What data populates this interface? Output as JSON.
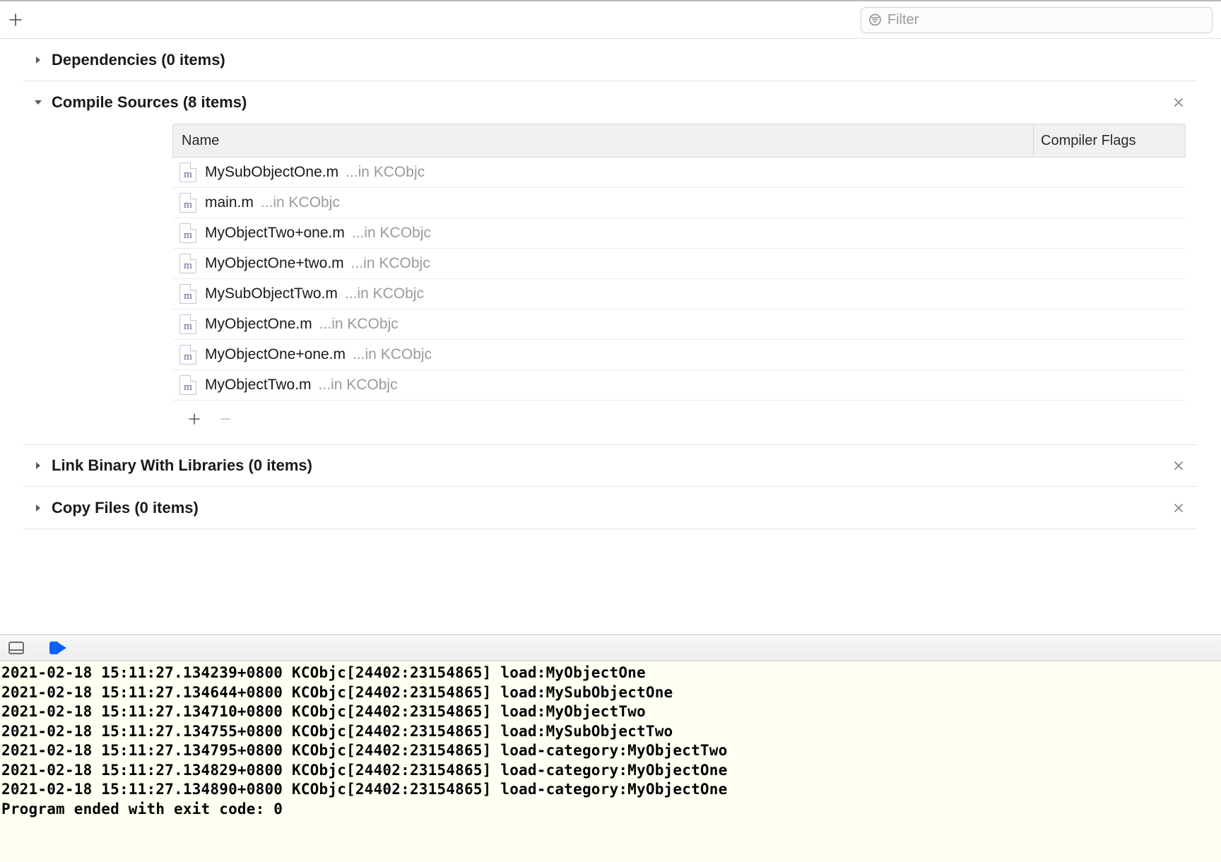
{
  "toolbar": {
    "filter_placeholder": "Filter"
  },
  "sections": {
    "dependencies": {
      "title": "Dependencies (0 items)",
      "expanded": false
    },
    "compile_sources": {
      "title": "Compile Sources (8 items)",
      "expanded": true
    },
    "link_binary": {
      "title": "Link Binary With Libraries (0 items)",
      "expanded": false
    },
    "copy_files": {
      "title": "Copy Files (0 items)",
      "expanded": false
    }
  },
  "table": {
    "columns": {
      "name": "Name",
      "flags": "Compiler Flags"
    },
    "rows": [
      {
        "file": "MySubObjectOne.m",
        "location": "...in KCObjc",
        "flags": ""
      },
      {
        "file": "main.m",
        "location": "...in KCObjc",
        "flags": ""
      },
      {
        "file": "MyObjectTwo+one.m",
        "location": "...in KCObjc",
        "flags": ""
      },
      {
        "file": "MyObjectOne+two.m",
        "location": "...in KCObjc",
        "flags": ""
      },
      {
        "file": "MySubObjectTwo.m",
        "location": "...in KCObjc",
        "flags": ""
      },
      {
        "file": "MyObjectOne.m",
        "location": "...in KCObjc",
        "flags": ""
      },
      {
        "file": "MyObjectOne+one.m",
        "location": "...in KCObjc",
        "flags": ""
      },
      {
        "file": "MyObjectTwo.m",
        "location": "...in KCObjc",
        "flags": ""
      }
    ],
    "file_icon_letter": "m"
  },
  "console": {
    "lines": [
      "2021-02-18 15:11:27.134239+0800 KCObjc[24402:23154865] load:MyObjectOne",
      "2021-02-18 15:11:27.134644+0800 KCObjc[24402:23154865] load:MySubObjectOne",
      "2021-02-18 15:11:27.134710+0800 KCObjc[24402:23154865] load:MyObjectTwo",
      "2021-02-18 15:11:27.134755+0800 KCObjc[24402:23154865] load:MySubObjectTwo",
      "2021-02-18 15:11:27.134795+0800 KCObjc[24402:23154865] load-category:MyObjectTwo",
      "2021-02-18 15:11:27.134829+0800 KCObjc[24402:23154865] load-category:MyObjectOne",
      "2021-02-18 15:11:27.134890+0800 KCObjc[24402:23154865] load-category:MyObjectOne",
      "Program ended with exit code: 0"
    ]
  }
}
